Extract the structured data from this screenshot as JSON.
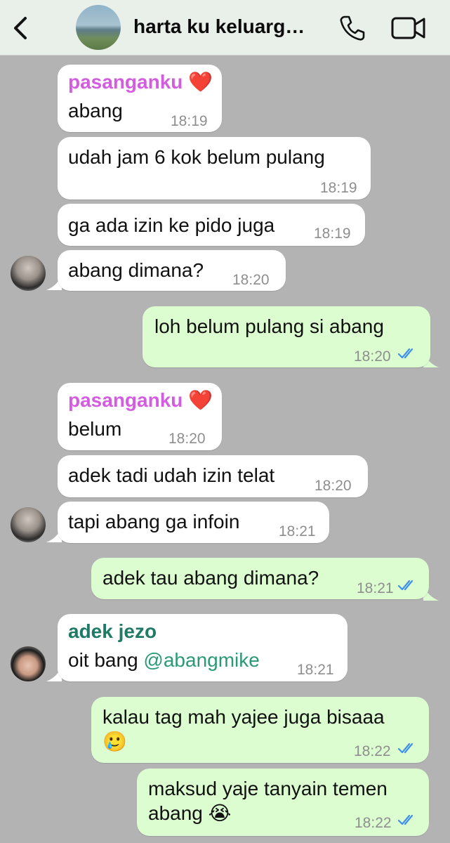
{
  "header": {
    "title": "harta ku keluarg…",
    "group_avatar_text": "",
    "icons": [
      "back-icon",
      "phone-icon",
      "video-icon"
    ]
  },
  "colors": {
    "chat_background": "#b3b3b3",
    "incoming_bubble": "#ffffff",
    "outgoing_bubble": "#dcfdd0",
    "sender_pasanganku": "#d45ce0",
    "sender_adek_jezo": "#1f7a66",
    "read_ticks": "#3f8ff0"
  },
  "messages": [
    {
      "sender": "pasanganku",
      "emoji": "❤️",
      "text": "abang",
      "time": "18:19"
    },
    {
      "text": "udah jam 6 kok belum pulang",
      "time": "18:19"
    },
    {
      "text": "ga ada izin ke pido juga",
      "time": "18:19"
    },
    {
      "text": "abang dimana?",
      "time": "18:20"
    },
    {
      "text": "loh belum pulang si abang",
      "time": "18:20"
    },
    {
      "sender": "pasanganku",
      "emoji": "❤️",
      "text": "belum",
      "time": "18:20"
    },
    {
      "text": "adek tadi udah izin telat",
      "time": "18:20"
    },
    {
      "text": "tapi abang ga infoin",
      "time": "18:21"
    },
    {
      "text": "adek tau abang dimana?",
      "time": "18:21"
    },
    {
      "sender": "adek jezo",
      "text": "oit bang ",
      "mention": "@abangmike",
      "time": "18:21"
    },
    {
      "text": "kalau tag mah yajee juga bisaaa",
      "emoji": "🥲",
      "time": "18:22"
    },
    {
      "text_line1": "maksud yaje tanyain temen",
      "text_line2": "abang",
      "emoji": "😭",
      "time": "18:22"
    }
  ]
}
